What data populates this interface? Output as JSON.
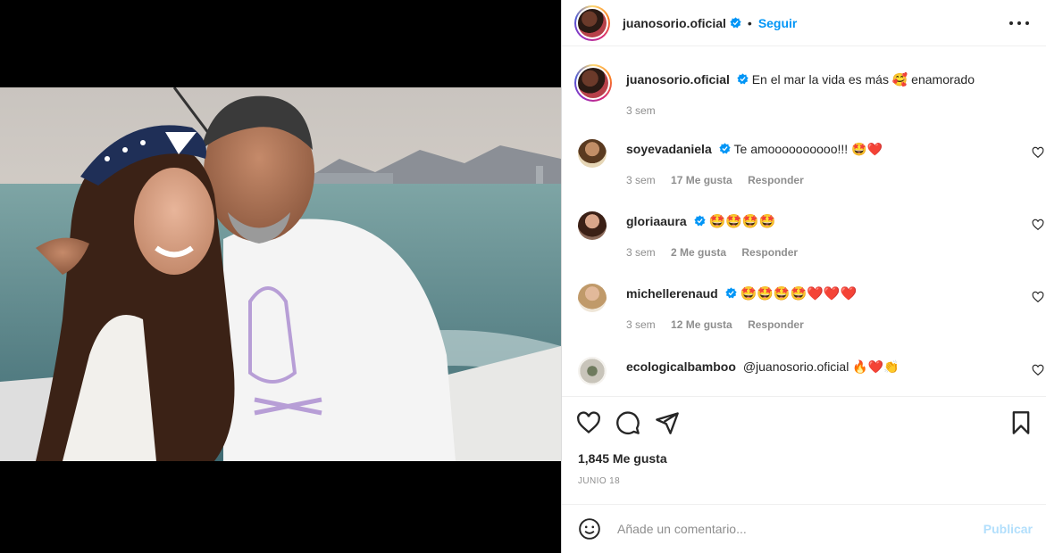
{
  "post": {
    "username": "juanosorio.oficial",
    "follow_label": "Seguir",
    "separator": "•"
  },
  "caption": {
    "username": "juanosorio.oficial",
    "text": "En el mar la vida es más 🥰 enamorado",
    "time": "3 sem"
  },
  "comments": [
    {
      "username": "soyevadaniela",
      "text": "Te amoooooooooo!!! 🤩❤️",
      "time": "3 sem",
      "likes": "17 Me gusta",
      "reply": "Responder",
      "verified": true
    },
    {
      "username": "gloriaaura",
      "text": "🤩🤩🤩🤩",
      "time": "3 sem",
      "likes": "2 Me gusta",
      "reply": "Responder",
      "verified": true
    },
    {
      "username": "michellerenaud",
      "text": "🤩🤩🤩🤩❤️❤️❤️",
      "time": "3 sem",
      "likes": "12 Me gusta",
      "reply": "Responder",
      "verified": true
    },
    {
      "username": "ecologicalbamboo",
      "text": "@juanosorio.oficial 🔥❤️👏",
      "verified": false
    }
  ],
  "footer": {
    "likes": "1,845 Me gusta",
    "date": "JUNIO 18",
    "comment_placeholder": "Añade un comentario...",
    "publish_label": "Publicar"
  },
  "colors": {
    "accent": "#0095f6",
    "publish_disabled": "#b2dffc",
    "secondary_text": "#8e8e8e"
  },
  "icons": [
    "verified-badge-icon",
    "more-options-icon",
    "heart-icon",
    "comment-icon",
    "share-icon",
    "bookmark-icon",
    "emoji-icon"
  ]
}
